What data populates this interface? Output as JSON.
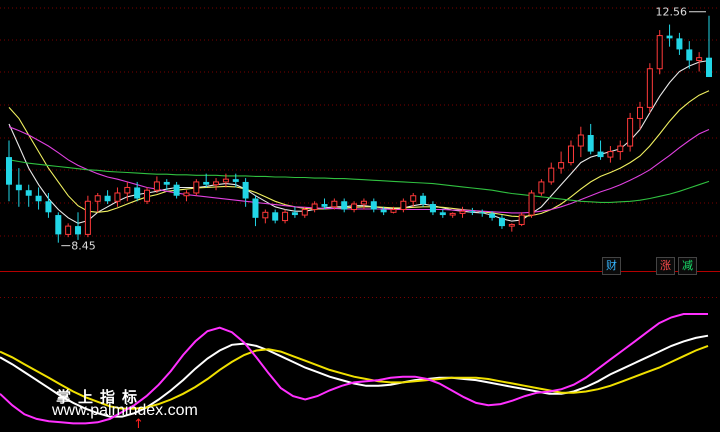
{
  "badges": {
    "cai": "财",
    "zhang": "涨",
    "jian": "减"
  },
  "watermark": {
    "cn": "掌上指标",
    "url": "www.palmindex.com"
  },
  "colors": {
    "background": "#000000",
    "grid": "#7a0000",
    "divider": "#b40000",
    "up": "#ff3a3a",
    "down": "#22d6e6",
    "ma_white": "#e8e8e8",
    "ma_yellow": "#f0f060",
    "ma_magenta": "#e040e0",
    "ma_green": "#30c040",
    "osc_white": "#ffffff",
    "osc_yellow": "#f0e000",
    "osc_magenta": "#ff30ff"
  },
  "chart_data": [
    {
      "type": "candlestick",
      "ylim": [
        8.1,
        12.7
      ],
      "high_label": "12.56",
      "low_label": "8.45",
      "candles": [
        [
          10.0,
          10.3,
          9.2,
          9.5
        ],
        [
          9.5,
          9.8,
          9.1,
          9.4
        ],
        [
          9.4,
          9.5,
          9.1,
          9.3
        ],
        [
          9.3,
          9.45,
          9.05,
          9.2
        ],
        [
          9.2,
          9.35,
          8.9,
          9.0
        ],
        [
          8.95,
          9.0,
          8.45,
          8.6
        ],
        [
          8.6,
          8.8,
          8.55,
          8.75
        ],
        [
          8.75,
          9.0,
          8.5,
          8.6
        ],
        [
          8.6,
          9.3,
          8.55,
          9.2
        ],
        [
          9.2,
          9.35,
          9.0,
          9.3
        ],
        [
          9.3,
          9.4,
          9.15,
          9.2
        ],
        [
          9.2,
          9.45,
          9.1,
          9.35
        ],
        [
          9.35,
          9.55,
          9.2,
          9.45
        ],
        [
          9.45,
          9.55,
          9.2,
          9.25
        ],
        [
          9.2,
          9.45,
          9.15,
          9.4
        ],
        [
          9.4,
          9.65,
          9.35,
          9.55
        ],
        [
          9.55,
          9.6,
          9.4,
          9.5
        ],
        [
          9.5,
          9.55,
          9.25,
          9.3
        ],
        [
          9.3,
          9.4,
          9.2,
          9.35
        ],
        [
          9.35,
          9.6,
          9.3,
          9.55
        ],
        [
          9.55,
          9.7,
          9.45,
          9.5
        ],
        [
          9.5,
          9.62,
          9.4,
          9.55
        ],
        [
          9.55,
          9.7,
          9.45,
          9.6
        ],
        [
          9.6,
          9.7,
          9.45,
          9.55
        ],
        [
          9.55,
          9.62,
          9.1,
          9.25
        ],
        [
          9.25,
          9.3,
          8.75,
          8.9
        ],
        [
          8.9,
          9.05,
          8.8,
          9.0
        ],
        [
          9.0,
          9.05,
          8.8,
          8.85
        ],
        [
          8.85,
          9.05,
          8.8,
          9.0
        ],
        [
          9.0,
          9.1,
          8.9,
          8.95
        ],
        [
          8.95,
          9.1,
          8.9,
          9.05
        ],
        [
          9.05,
          9.2,
          9.0,
          9.15
        ],
        [
          9.15,
          9.25,
          9.05,
          9.1
        ],
        [
          9.1,
          9.25,
          9.05,
          9.2
        ],
        [
          9.2,
          9.25,
          9.0,
          9.05
        ],
        [
          9.05,
          9.2,
          9.0,
          9.15
        ],
        [
          9.15,
          9.25,
          9.05,
          9.2
        ],
        [
          9.2,
          9.25,
          9.0,
          9.05
        ],
        [
          9.05,
          9.1,
          8.95,
          9.0
        ],
        [
          9.0,
          9.1,
          8.98,
          9.05
        ],
        [
          9.05,
          9.25,
          9.0,
          9.2
        ],
        [
          9.2,
          9.35,
          9.1,
          9.3
        ],
        [
          9.3,
          9.35,
          9.1,
          9.15
        ],
        [
          9.15,
          9.2,
          8.95,
          9.0
        ],
        [
          9.0,
          9.05,
          8.9,
          8.95
        ],
        [
          8.95,
          9.0,
          8.9,
          8.98
        ],
        [
          8.98,
          9.1,
          8.9,
          9.02
        ],
        [
          9.02,
          9.08,
          8.95,
          9.0
        ],
        [
          9.0,
          9.05,
          8.92,
          8.98
        ],
        [
          8.98,
          9.02,
          8.85,
          8.9
        ],
        [
          8.9,
          8.95,
          8.7,
          8.75
        ],
        [
          8.75,
          8.8,
          8.65,
          8.78
        ],
        [
          8.78,
          9.0,
          8.75,
          8.95
        ],
        [
          8.95,
          9.4,
          8.9,
          9.35
        ],
        [
          9.35,
          9.6,
          9.3,
          9.55
        ],
        [
          9.55,
          9.9,
          9.5,
          9.8
        ],
        [
          9.8,
          10.1,
          9.7,
          9.9
        ],
        [
          9.9,
          10.3,
          9.85,
          10.2
        ],
        [
          10.2,
          10.55,
          10.0,
          10.4
        ],
        [
          10.4,
          10.6,
          10.05,
          10.1
        ],
        [
          10.1,
          10.3,
          9.95,
          10.0
        ],
        [
          10.0,
          10.2,
          9.9,
          10.1
        ],
        [
          10.1,
          10.3,
          9.95,
          10.2
        ],
        [
          10.2,
          10.8,
          10.1,
          10.7
        ],
        [
          10.7,
          11.0,
          10.5,
          10.9
        ],
        [
          10.9,
          11.7,
          10.8,
          11.6
        ],
        [
          11.6,
          12.3,
          11.5,
          12.2
        ],
        [
          12.2,
          12.4,
          12.0,
          12.15
        ],
        [
          12.15,
          12.25,
          11.85,
          11.95
        ],
        [
          11.95,
          12.1,
          11.6,
          11.75
        ],
        [
          11.75,
          11.9,
          11.55,
          11.8
        ],
        [
          11.8,
          12.56,
          11.7,
          11.45
        ]
      ],
      "ma_series": [
        {
          "color": "#e8e8e8",
          "values": [
            10.6,
            10.2,
            9.8,
            9.5,
            9.25,
            9.05,
            8.9,
            8.8,
            8.85,
            9.0,
            9.1,
            9.2,
            9.28,
            9.32,
            9.35,
            9.38,
            9.42,
            9.45,
            9.45,
            9.45,
            9.47,
            9.5,
            9.52,
            9.5,
            9.42,
            9.3,
            9.2,
            9.1,
            9.05,
            9.02,
            9.02,
            9.05,
            9.08,
            9.1,
            9.1,
            9.12,
            9.12,
            9.1,
            9.08,
            9.06,
            9.08,
            9.12,
            9.15,
            9.12,
            9.08,
            9.04,
            9.02,
            9.0,
            8.99,
            8.95,
            8.88,
            8.84,
            8.86,
            8.98,
            9.1,
            9.3,
            9.5,
            9.7,
            9.9,
            10.0,
            10.05,
            10.1,
            10.15,
            10.3,
            10.5,
            10.8,
            11.1,
            11.35,
            11.55,
            11.65,
            11.72,
            11.75
          ]
        },
        {
          "color": "#f0f060",
          "values": [
            10.9,
            10.7,
            10.4,
            10.1,
            9.8,
            9.55,
            9.3,
            9.12,
            9.02,
            9.0,
            9.02,
            9.08,
            9.15,
            9.22,
            9.28,
            9.32,
            9.38,
            9.4,
            9.42,
            9.44,
            9.45,
            9.46,
            9.47,
            9.46,
            9.42,
            9.36,
            9.28,
            9.2,
            9.14,
            9.1,
            9.07,
            9.06,
            9.06,
            9.07,
            9.08,
            9.09,
            9.1,
            9.1,
            9.09,
            9.08,
            9.08,
            9.09,
            9.1,
            9.1,
            9.09,
            9.07,
            9.05,
            9.03,
            9.01,
            8.99,
            8.96,
            8.93,
            8.92,
            8.94,
            8.98,
            9.05,
            9.15,
            9.28,
            9.42,
            9.55,
            9.65,
            9.72,
            9.8,
            9.9,
            10.02,
            10.2,
            10.42,
            10.65,
            10.85,
            11.0,
            11.12,
            11.2
          ]
        },
        {
          "color": "#e040e0",
          "values": [
            10.55,
            10.48,
            10.4,
            10.3,
            10.2,
            10.08,
            9.95,
            9.85,
            9.77,
            9.7,
            9.64,
            9.6,
            9.55,
            9.5,
            9.45,
            9.42,
            9.38,
            9.35,
            9.32,
            9.3,
            9.28,
            9.26,
            9.24,
            9.22,
            9.2,
            9.18,
            9.16,
            9.14,
            9.12,
            9.1,
            9.09,
            9.08,
            9.07,
            9.07,
            9.06,
            9.06,
            9.06,
            9.06,
            9.06,
            9.05,
            9.05,
            9.05,
            9.05,
            9.05,
            9.05,
            9.04,
            9.04,
            9.03,
            9.02,
            9.01,
            9.0,
            8.99,
            8.99,
            9.0,
            9.02,
            9.05,
            9.1,
            9.16,
            9.23,
            9.3,
            9.37,
            9.43,
            9.5,
            9.58,
            9.67,
            9.77,
            9.9,
            10.03,
            10.17,
            10.3,
            10.42,
            10.5
          ]
        },
        {
          "color": "#30c040",
          "values": [
            9.95,
            9.92,
            9.89,
            9.87,
            9.85,
            9.83,
            9.81,
            9.79,
            9.77,
            9.76,
            9.74,
            9.73,
            9.72,
            9.71,
            9.7,
            9.69,
            9.69,
            9.68,
            9.68,
            9.67,
            9.67,
            9.67,
            9.66,
            9.66,
            9.66,
            9.65,
            9.65,
            9.64,
            9.64,
            9.63,
            9.63,
            9.62,
            9.62,
            9.61,
            9.61,
            9.6,
            9.59,
            9.58,
            9.57,
            9.56,
            9.55,
            9.54,
            9.53,
            9.52,
            9.5,
            9.48,
            9.46,
            9.44,
            9.42,
            9.4,
            9.37,
            9.34,
            9.32,
            9.3,
            9.28,
            9.26,
            9.24,
            9.22,
            9.2,
            9.19,
            9.18,
            9.18,
            9.19,
            9.2,
            9.22,
            9.25,
            9.29,
            9.33,
            9.38,
            9.44,
            9.5,
            9.56
          ]
        }
      ]
    },
    {
      "type": "line",
      "ylim": [
        0,
        100
      ],
      "series": [
        {
          "color": "#ffffff",
          "values": [
            62,
            56,
            49,
            42,
            35,
            28,
            22,
            17,
            13,
            10,
            10,
            13,
            18,
            25,
            33,
            42,
            52,
            61,
            68,
            73,
            74,
            72,
            68,
            63,
            58,
            53,
            49,
            45,
            42,
            39,
            37,
            37,
            38,
            40,
            42,
            43,
            44,
            44,
            43,
            42,
            40,
            38,
            36,
            34,
            32,
            30,
            30,
            32,
            36,
            41,
            47,
            52,
            57,
            62,
            67,
            72,
            76,
            79,
            81
          ]
        },
        {
          "color": "#f0e000",
          "values": [
            67,
            62,
            56,
            50,
            44,
            38,
            32,
            27,
            23,
            19,
            17,
            17,
            18,
            21,
            25,
            30,
            36,
            43,
            51,
            58,
            64,
            68,
            69,
            67,
            63,
            59,
            55,
            51,
            48,
            45,
            43,
            41,
            40,
            40,
            41,
            42,
            43,
            44,
            44,
            44,
            43,
            41,
            39,
            37,
            35,
            33,
            31,
            31,
            32,
            34,
            37,
            41,
            45,
            49,
            53,
            58,
            63,
            68,
            72
          ]
        },
        {
          "color": "#ff30ff",
          "values": [
            30,
            20,
            12,
            8,
            6,
            5,
            4,
            4,
            5,
            8,
            14,
            20,
            28,
            38,
            50,
            64,
            76,
            85,
            88,
            84,
            75,
            62,
            48,
            35,
            28,
            25,
            28,
            33,
            37,
            40,
            41,
            42,
            44,
            45,
            45,
            43,
            39,
            33,
            27,
            22,
            20,
            21,
            24,
            28,
            31,
            32,
            34,
            38,
            44,
            52,
            60,
            68,
            76,
            84,
            92,
            97,
            100,
            100,
            100
          ]
        }
      ]
    }
  ]
}
